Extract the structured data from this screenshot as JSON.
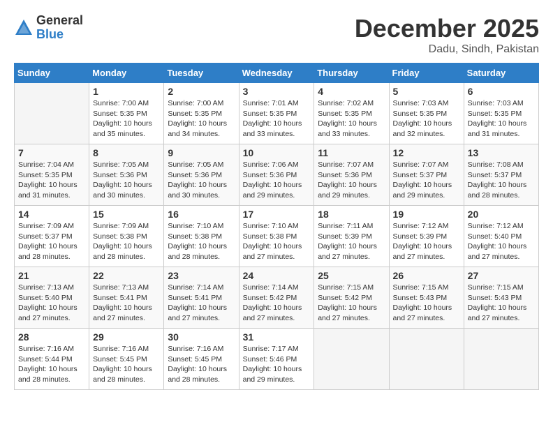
{
  "header": {
    "logo_general": "General",
    "logo_blue": "Blue",
    "month": "December 2025",
    "location": "Dadu, Sindh, Pakistan"
  },
  "days_of_week": [
    "Sunday",
    "Monday",
    "Tuesday",
    "Wednesday",
    "Thursday",
    "Friday",
    "Saturday"
  ],
  "weeks": [
    [
      {
        "day": "",
        "info": ""
      },
      {
        "day": "1",
        "info": "Sunrise: 7:00 AM\nSunset: 5:35 PM\nDaylight: 10 hours\nand 35 minutes."
      },
      {
        "day": "2",
        "info": "Sunrise: 7:00 AM\nSunset: 5:35 PM\nDaylight: 10 hours\nand 34 minutes."
      },
      {
        "day": "3",
        "info": "Sunrise: 7:01 AM\nSunset: 5:35 PM\nDaylight: 10 hours\nand 33 minutes."
      },
      {
        "day": "4",
        "info": "Sunrise: 7:02 AM\nSunset: 5:35 PM\nDaylight: 10 hours\nand 33 minutes."
      },
      {
        "day": "5",
        "info": "Sunrise: 7:03 AM\nSunset: 5:35 PM\nDaylight: 10 hours\nand 32 minutes."
      },
      {
        "day": "6",
        "info": "Sunrise: 7:03 AM\nSunset: 5:35 PM\nDaylight: 10 hours\nand 31 minutes."
      }
    ],
    [
      {
        "day": "7",
        "info": "Sunrise: 7:04 AM\nSunset: 5:35 PM\nDaylight: 10 hours\nand 31 minutes."
      },
      {
        "day": "8",
        "info": "Sunrise: 7:05 AM\nSunset: 5:36 PM\nDaylight: 10 hours\nand 30 minutes."
      },
      {
        "day": "9",
        "info": "Sunrise: 7:05 AM\nSunset: 5:36 PM\nDaylight: 10 hours\nand 30 minutes."
      },
      {
        "day": "10",
        "info": "Sunrise: 7:06 AM\nSunset: 5:36 PM\nDaylight: 10 hours\nand 29 minutes."
      },
      {
        "day": "11",
        "info": "Sunrise: 7:07 AM\nSunset: 5:36 PM\nDaylight: 10 hours\nand 29 minutes."
      },
      {
        "day": "12",
        "info": "Sunrise: 7:07 AM\nSunset: 5:37 PM\nDaylight: 10 hours\nand 29 minutes."
      },
      {
        "day": "13",
        "info": "Sunrise: 7:08 AM\nSunset: 5:37 PM\nDaylight: 10 hours\nand 28 minutes."
      }
    ],
    [
      {
        "day": "14",
        "info": "Sunrise: 7:09 AM\nSunset: 5:37 PM\nDaylight: 10 hours\nand 28 minutes."
      },
      {
        "day": "15",
        "info": "Sunrise: 7:09 AM\nSunset: 5:38 PM\nDaylight: 10 hours\nand 28 minutes."
      },
      {
        "day": "16",
        "info": "Sunrise: 7:10 AM\nSunset: 5:38 PM\nDaylight: 10 hours\nand 28 minutes."
      },
      {
        "day": "17",
        "info": "Sunrise: 7:10 AM\nSunset: 5:38 PM\nDaylight: 10 hours\nand 27 minutes."
      },
      {
        "day": "18",
        "info": "Sunrise: 7:11 AM\nSunset: 5:39 PM\nDaylight: 10 hours\nand 27 minutes."
      },
      {
        "day": "19",
        "info": "Sunrise: 7:12 AM\nSunset: 5:39 PM\nDaylight: 10 hours\nand 27 minutes."
      },
      {
        "day": "20",
        "info": "Sunrise: 7:12 AM\nSunset: 5:40 PM\nDaylight: 10 hours\nand 27 minutes."
      }
    ],
    [
      {
        "day": "21",
        "info": "Sunrise: 7:13 AM\nSunset: 5:40 PM\nDaylight: 10 hours\nand 27 minutes."
      },
      {
        "day": "22",
        "info": "Sunrise: 7:13 AM\nSunset: 5:41 PM\nDaylight: 10 hours\nand 27 minutes."
      },
      {
        "day": "23",
        "info": "Sunrise: 7:14 AM\nSunset: 5:41 PM\nDaylight: 10 hours\nand 27 minutes."
      },
      {
        "day": "24",
        "info": "Sunrise: 7:14 AM\nSunset: 5:42 PM\nDaylight: 10 hours\nand 27 minutes."
      },
      {
        "day": "25",
        "info": "Sunrise: 7:15 AM\nSunset: 5:42 PM\nDaylight: 10 hours\nand 27 minutes."
      },
      {
        "day": "26",
        "info": "Sunrise: 7:15 AM\nSunset: 5:43 PM\nDaylight: 10 hours\nand 27 minutes."
      },
      {
        "day": "27",
        "info": "Sunrise: 7:15 AM\nSunset: 5:43 PM\nDaylight: 10 hours\nand 27 minutes."
      }
    ],
    [
      {
        "day": "28",
        "info": "Sunrise: 7:16 AM\nSunset: 5:44 PM\nDaylight: 10 hours\nand 28 minutes."
      },
      {
        "day": "29",
        "info": "Sunrise: 7:16 AM\nSunset: 5:45 PM\nDaylight: 10 hours\nand 28 minutes."
      },
      {
        "day": "30",
        "info": "Sunrise: 7:16 AM\nSunset: 5:45 PM\nDaylight: 10 hours\nand 28 minutes."
      },
      {
        "day": "31",
        "info": "Sunrise: 7:17 AM\nSunset: 5:46 PM\nDaylight: 10 hours\nand 29 minutes."
      },
      {
        "day": "",
        "info": ""
      },
      {
        "day": "",
        "info": ""
      },
      {
        "day": "",
        "info": ""
      }
    ]
  ]
}
